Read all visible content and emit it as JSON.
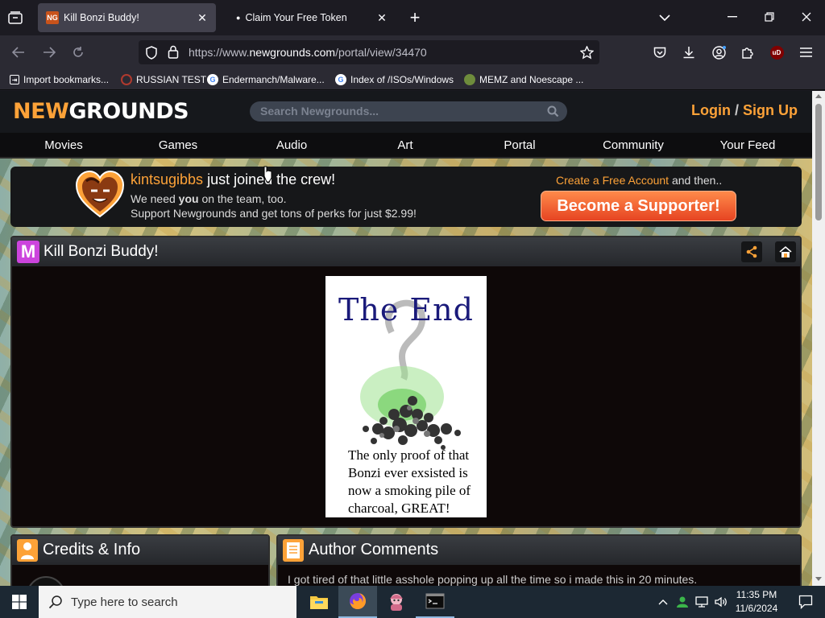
{
  "browser": {
    "tabs": [
      {
        "title": "Kill Bonzi Buddy!",
        "favicon": "NG",
        "active": true
      },
      {
        "title": "Claim Your Free Token",
        "active": false
      }
    ],
    "url": {
      "prefix": "https://www.",
      "domain": "newgrounds.com",
      "path": "/portal/view/34470"
    },
    "bookmarks": [
      {
        "label": "Import bookmarks...",
        "icon": "import-icon"
      },
      {
        "label": "RUSSIAN TEST",
        "icon": "russian-test-icon"
      },
      {
        "label": "Endermanch/Malware...",
        "icon": "google-icon"
      },
      {
        "label": "Index of /ISOs/Windows",
        "icon": "google-icon"
      },
      {
        "label": "MEMZ and Noescape ...",
        "icon": "memz-icon"
      }
    ],
    "extension_badge": "uD"
  },
  "site": {
    "logo": {
      "part1": "NEW",
      "part2": "GROUNDS"
    },
    "search_placeholder": "Search Newgrounds...",
    "login": "Login",
    "separator": "/",
    "signup": "Sign Up",
    "nav": [
      "Movies",
      "Games",
      "Audio",
      "Art",
      "Portal",
      "Community",
      "Your Feed"
    ]
  },
  "banner": {
    "username": "kintsugibbs",
    "title_rest": " just joined the crew!",
    "line1_pre": "We need ",
    "line1_bold": "you",
    "line1_post": " on the team, too.",
    "line2": "Support Newgrounds and get tons of perks for just $2.99!",
    "cta_link": "Create a Free Account",
    "cta_rest": " and then..",
    "button": "Become a Supporter!"
  },
  "game": {
    "icon_letter": "M",
    "title": "Kill Bonzi Buddy!",
    "frame_title": "The End",
    "frame_caption": "The only proof of that Bonzi ever exsisted is now a smoking pile of charcoal, GREAT!"
  },
  "panels": {
    "credits_title": "Credits & Info",
    "author_title": "Author Comments",
    "author_text": "I got tired of that little asshole popping up all the time so i made this in 20 minutes."
  },
  "taskbar": {
    "search_placeholder": "Type here to search",
    "time": "11:35 PM",
    "date": "11/6/2024"
  },
  "colors": {
    "accent": "#fda238",
    "supporter_button": "#ef5a2c",
    "game_icon": "#cc44dd"
  }
}
